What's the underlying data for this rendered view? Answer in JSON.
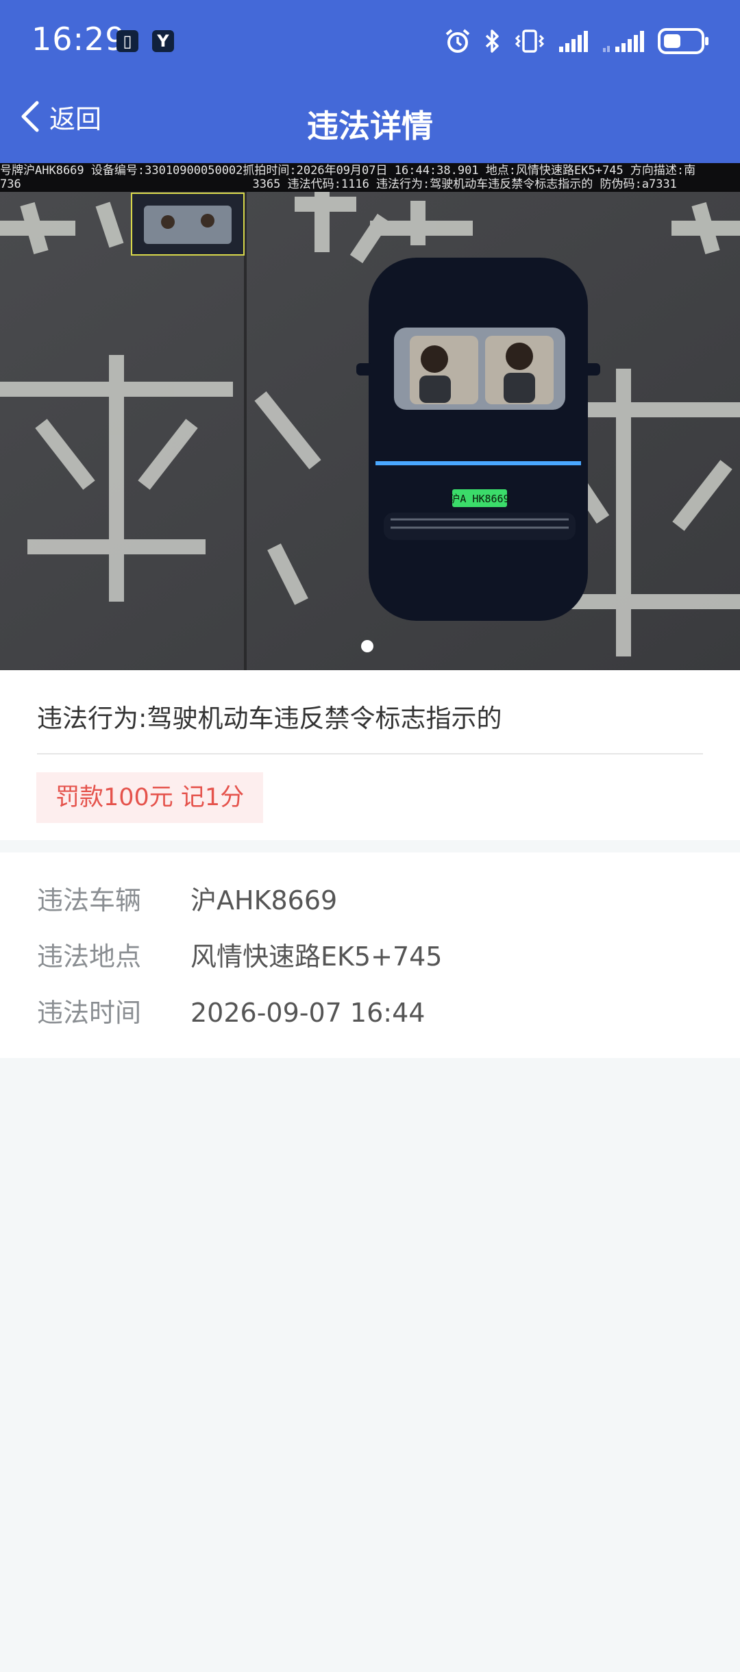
{
  "status_bar": {
    "time": "16:29",
    "icons": [
      "notification-app-icon",
      "yandex-app-icon",
      "alarm-icon",
      "bluetooth-icon",
      "vibrate-icon",
      "signal-icon",
      "signal-icon",
      "battery-icon"
    ]
  },
  "nav": {
    "back_label": "返回",
    "title": "违法详情"
  },
  "photo": {
    "caption_line1": "号牌沪AHK8669 设备编号:33010900050002抓拍时间:2026年09月07日 16:44:38.901 地点:风情快速路EK5+745 方向描述:南",
    "caption_line2": "736                                 3365 违法代码:1116 违法行为:驾驶机动车违反禁令标志指示的 防伪码:a7331",
    "plate_text": "沪A HK8669",
    "carousel_total": 1,
    "carousel_index": 1
  },
  "violation": {
    "behavior_label": "违法行为:",
    "behavior_value": "驾驶机动车违反禁令标志指示的",
    "penalty": "罚款100元 记1分"
  },
  "details": [
    {
      "label": "违法车辆",
      "value": "沪AHK8669"
    },
    {
      "label": "违法地点",
      "value": "风情快速路EK5+745"
    },
    {
      "label": "违法时间",
      "value": "2026-09-07 16:44"
    }
  ],
  "colors": {
    "header": "#4469d8",
    "penalty_text": "#e5534c",
    "penalty_bg": "#fdeeee",
    "page_bg": "#f4f7f8"
  }
}
